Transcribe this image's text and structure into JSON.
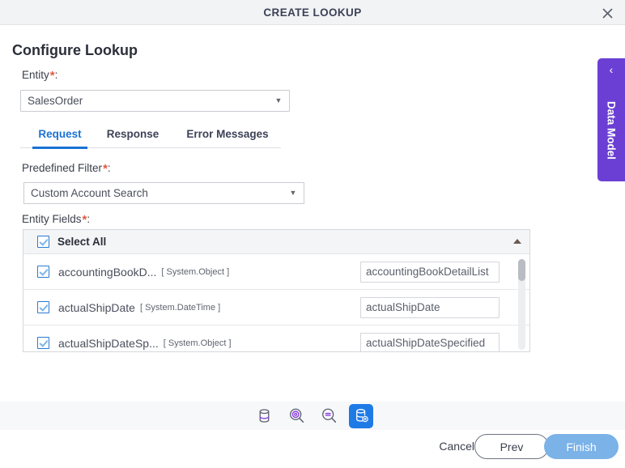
{
  "window": {
    "title": "CREATE LOOKUP",
    "close_icon": "close-icon"
  },
  "page": {
    "title": "Configure Lookup"
  },
  "entity": {
    "label": "Entity",
    "required_marker": "*",
    "colon": ":",
    "selected": "SalesOrder",
    "caret_icon": "chevron-down-icon"
  },
  "tabs": [
    {
      "label": "Request",
      "active": true
    },
    {
      "label": "Response",
      "active": false
    },
    {
      "label": "Error Messages",
      "active": false
    }
  ],
  "predefined_filter": {
    "label": "Predefined Filter",
    "required_marker": "*",
    "colon": ":",
    "selected": "Custom Account Search",
    "caret_icon": "chevron-down-icon"
  },
  "entity_fields": {
    "label": "Entity Fields",
    "required_marker": "*",
    "colon": ":",
    "select_all_label": "Select All",
    "select_all_checked": true,
    "sort_icon": "sort-ascending-arrow-icon",
    "rows": [
      {
        "checked": true,
        "name": "accountingBookD...",
        "type": "[ System.Object ]",
        "value": "accountingBookDetailList"
      },
      {
        "checked": true,
        "name": "actualShipDate",
        "type": "[ System.DateTime ]",
        "value": "actualShipDate"
      },
      {
        "checked": true,
        "name": "actualShipDateSp...",
        "type": "[ System.Object ]",
        "value": "actualShipDateSpecified"
      }
    ]
  },
  "toolbar": {
    "buttons": [
      {
        "icon": "database-icon",
        "active": false
      },
      {
        "icon": "database-search-settings-icon",
        "active": false
      },
      {
        "icon": "search-minus-icon",
        "active": false
      },
      {
        "icon": "database-settings-icon",
        "active": true
      }
    ]
  },
  "footer": {
    "cancel_label": "Cancel",
    "prev_label": "Prev",
    "finish_label": "Finish"
  },
  "side_panel": {
    "label": "Data Model",
    "chevron_icon": "chevron-left-icon"
  },
  "colors": {
    "accent_blue": "#1a73d4",
    "purple": "#6b3fd4",
    "toolbar_active": "#1e7ae5",
    "finish_button": "#7bb2e8",
    "required_star": "#e8543f",
    "titlebar_bg": "#f2f3f5"
  }
}
